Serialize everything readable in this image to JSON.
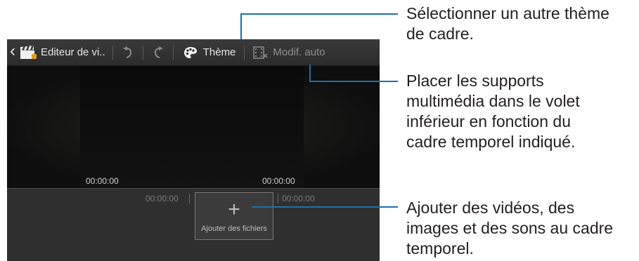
{
  "app": {
    "back_glyph": "‹",
    "title": "Editeur de vi..",
    "theme_label": "Thème",
    "auto_label": "Modif. auto"
  },
  "preview": {
    "time_start": "00:00:00",
    "time_end": "00:00:00"
  },
  "timeline": {
    "time_left": "00:00:00",
    "time_right": "00:00:00",
    "add_plus": "+",
    "add_label": "Ajouter des fichiers"
  },
  "callouts": {
    "theme": [
      "Sélectionner un autre thème",
      "de cadre."
    ],
    "auto": [
      "Placer les supports",
      "multimédia dans le volet",
      "inférieur en fonction du",
      "cadre temporel indiqué."
    ],
    "add": [
      "Ajouter des vidéos, des",
      "images et des sons au cadre",
      "temporel."
    ]
  },
  "colors": {
    "callout_line": "#1f6fa8",
    "callout_text": "#231f20"
  },
  "icons": [
    "back-chevron-icon",
    "clapperboard-icon",
    "undo-icon",
    "redo-icon",
    "palette-icon",
    "film-auto-edit-icon",
    "plus-icon"
  ]
}
